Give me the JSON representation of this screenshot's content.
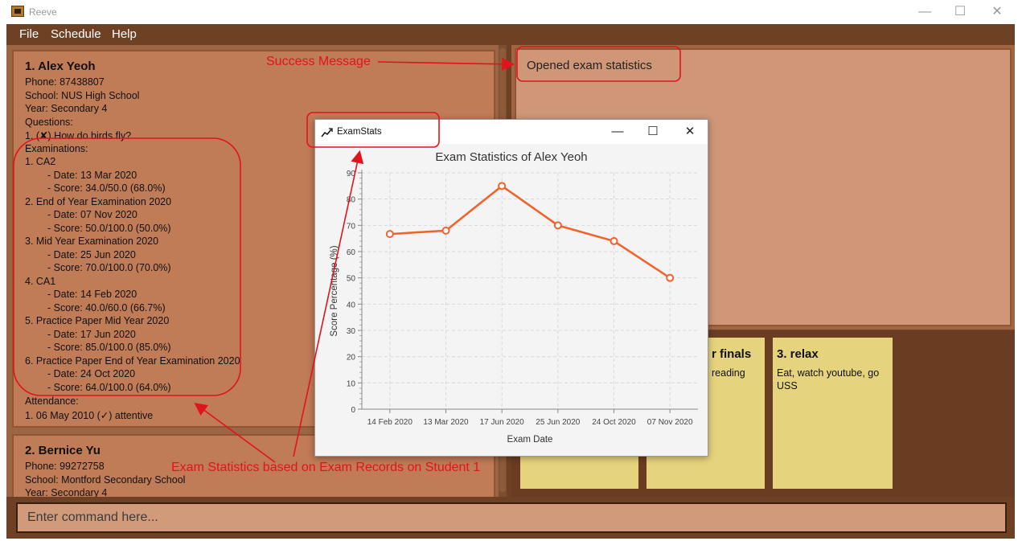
{
  "window": {
    "title": "Reeve",
    "controls": [
      "—",
      "☐",
      "✕"
    ]
  },
  "menu": [
    "File",
    "Schedule",
    "Help"
  ],
  "students": [
    {
      "name": "1.  Alex Yeoh",
      "lines": [
        "Phone: 87438807",
        "School: NUS High School",
        "Year: Secondary 4",
        "Questions:",
        "1. (✘) How do birds fly?",
        "Examinations:",
        "1. CA2",
        "- Date: 13 Mar 2020",
        "- Score: 34.0/50.0 (68.0%)",
        "2. End of Year Examination 2020",
        "- Date: 07 Nov 2020",
        "- Score: 50.0/100.0 (50.0%)",
        "3. Mid Year Examination 2020",
        "- Date: 25 Jun 2020",
        "- Score: 70.0/100.0 (70.0%)",
        "4. CA1",
        "- Date: 14 Feb 2020",
        "- Score: 40.0/60.0 (66.7%)",
        "5. Practice Paper Mid Year 2020",
        "- Date: 17 Jun 2020",
        "- Score: 85.0/100.0 (85.0%)",
        "6. Practice Paper End of Year Examination 2020",
        "- Date: 24 Oct 2020",
        "- Score: 64.0/100.0 (64.0%)",
        "Attendance:",
        "1. 06 May 2010 (✓) attentive"
      ]
    },
    {
      "name": "2.  Bernice Yu",
      "lines": [
        "Phone: 99272758",
        "School: Montford Secondary School",
        "Year: Secondary 4"
      ]
    }
  ],
  "result": {
    "text": "Opened exam statistics"
  },
  "schedule": [
    {
      "title": "r finals",
      "desc": "reading"
    },
    {
      "title": "3. relax",
      "desc": "Eat, watch youtube, go USS"
    }
  ],
  "command": {
    "placeholder": "Enter command here..."
  },
  "annotations": {
    "success": "Success Message",
    "exam_stats": "Exam Statistics based on Exam Records on Student 1"
  },
  "exam_window": {
    "title": "ExamStats",
    "controls": [
      "—",
      "☐",
      "✕"
    ]
  },
  "chart_data": {
    "type": "line",
    "title": "Exam Statistics of Alex Yeoh",
    "xlabel": "Exam Date",
    "ylabel": "Score Percentage (%)",
    "categories": [
      "14 Feb 2020",
      "13 Mar 2020",
      "17 Jun 2020",
      "25 Jun 2020",
      "24 Oct 2020",
      "07 Nov 2020"
    ],
    "values": [
      66.7,
      68.0,
      85.0,
      70.0,
      64.0,
      50.0
    ],
    "ylim": [
      0,
      90
    ],
    "yticks": [
      0,
      10,
      20,
      30,
      40,
      50,
      60,
      70,
      80,
      90
    ],
    "grid": true,
    "line_color": "#f0632c"
  }
}
